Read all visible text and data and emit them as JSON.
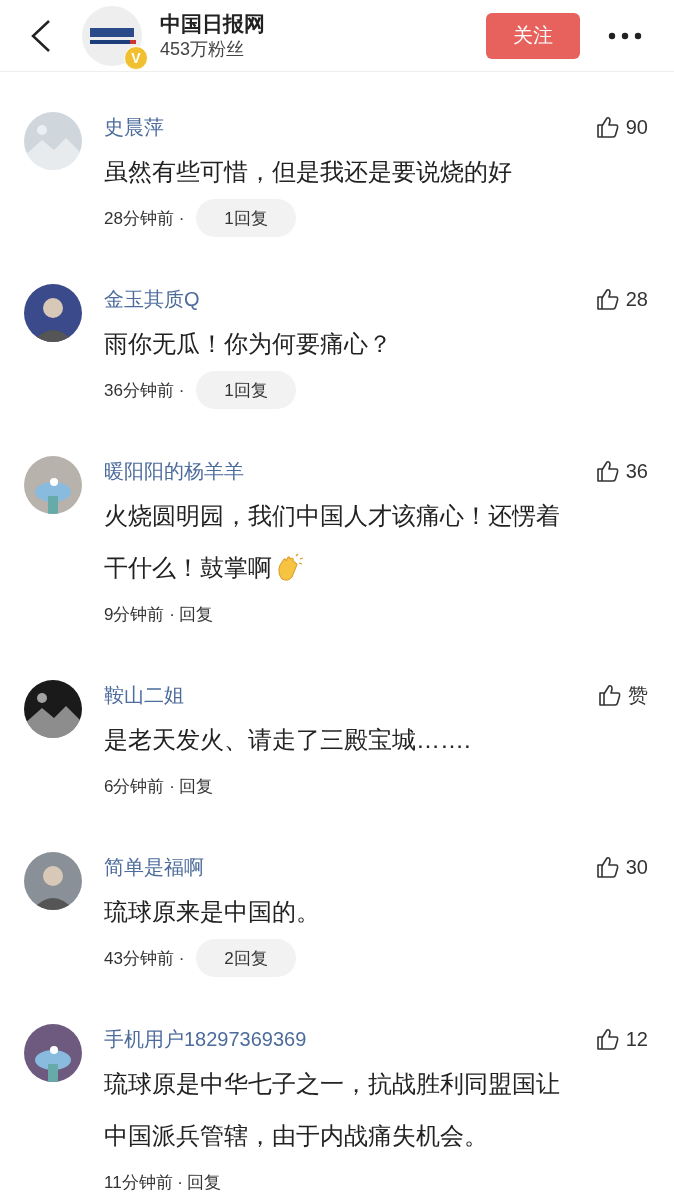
{
  "header": {
    "title": "中国日报网",
    "followers": "453万粉丝",
    "badge": "V",
    "follow_button": "关注"
  },
  "comments": [
    {
      "name": "史晨萍",
      "likes": "90",
      "text": [
        "虽然有些可惜，但是我还是要说烧的好"
      ],
      "clap_emoji": false,
      "time": "28分钟前 ·",
      "reply": {
        "label": "1回复",
        "kind": "pill"
      }
    },
    {
      "name": "金玉其质Q",
      "likes": "28",
      "text": [
        "雨你无瓜！你为何要痛心？"
      ],
      "clap_emoji": false,
      "time": "36分钟前 ·",
      "reply": {
        "label": "1回复",
        "kind": "pill"
      }
    },
    {
      "name": "暖阳阳的杨羊羊",
      "likes": "36",
      "text": [
        "火烧圆明园，我们中国人才该痛心！还愣着",
        "干什么！鼓掌啊"
      ],
      "clap_emoji": true,
      "time": "9分钟前 ·",
      "reply": {
        "label": "回复",
        "kind": "plain"
      }
    },
    {
      "name": "鞍山二姐",
      "likes": "赞",
      "text": [
        "是老天发火、请走了三殿宝城……."
      ],
      "clap_emoji": false,
      "time": "6分钟前 ·",
      "reply": {
        "label": "回复",
        "kind": "plain"
      }
    },
    {
      "name": "简单是福啊",
      "likes": "30",
      "text": [
        "琉球原来是中国的。"
      ],
      "clap_emoji": false,
      "time": "43分钟前 ·",
      "reply": {
        "label": "2回复",
        "kind": "pill"
      }
    },
    {
      "name": "手机用户18297369369",
      "likes": "12",
      "text": [
        "琉球原是中华七子之一，抗战胜利同盟国让",
        "中国派兵管辖，由于内战痛失机会。"
      ],
      "clap_emoji": false,
      "time": "11分钟前 ·",
      "reply": {
        "label": "回复",
        "kind": "plain"
      }
    }
  ]
}
